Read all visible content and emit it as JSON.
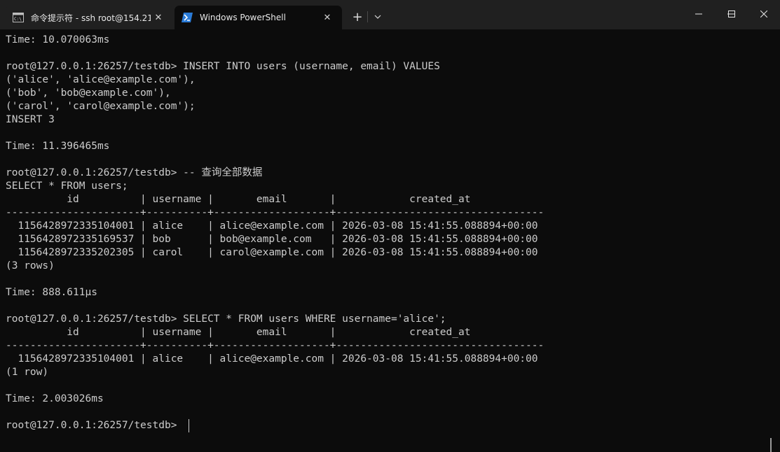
{
  "tabs": [
    {
      "label": "命令提示符 - ssh  root@154.21",
      "icon": "cmd-icon",
      "active": false
    },
    {
      "label": "Windows PowerShell",
      "icon": "powershell-icon",
      "active": true
    }
  ],
  "new_tab_symbol": "+",
  "dropdown_symbol": "⌄",
  "close_symbol": "✕",
  "terminal_lines": [
    "Time: 10.070063ms",
    "",
    "root@127.0.0.1:26257/testdb> INSERT INTO users (username, email) VALUES",
    "('alice', 'alice@example.com'),",
    "('bob', 'bob@example.com'),",
    "('carol', 'carol@example.com');",
    "INSERT 3",
    "",
    "Time: 11.396465ms",
    "",
    "root@127.0.0.1:26257/testdb> -- 查询全部数据",
    "SELECT * FROM users;",
    "          id          | username |       email       |            created_at",
    "----------------------+----------+-------------------+----------------------------------",
    "  1156428972335104001 | alice    | alice@example.com | 2026-03-08 15:41:55.088894+00:00",
    "  1156428972335169537 | bob      | bob@example.com   | 2026-03-08 15:41:55.088894+00:00",
    "  1156428972335202305 | carol    | carol@example.com | 2026-03-08 15:41:55.088894+00:00",
    "(3 rows)",
    "",
    "Time: 888.611µs",
    "",
    "root@127.0.0.1:26257/testdb> SELECT * FROM users WHERE username='alice';",
    "          id          | username |       email       |            created_at",
    "----------------------+----------+-------------------+----------------------------------",
    "  1156428972335104001 | alice    | alice@example.com | 2026-03-08 15:41:55.088894+00:00",
    "(1 row)",
    "",
    "Time: 2.003026ms",
    "",
    "root@127.0.0.1:26257/testdb> "
  ],
  "colors": {
    "background": "#0c0c0c",
    "titlebar": "#202020",
    "text": "#cccccc"
  }
}
